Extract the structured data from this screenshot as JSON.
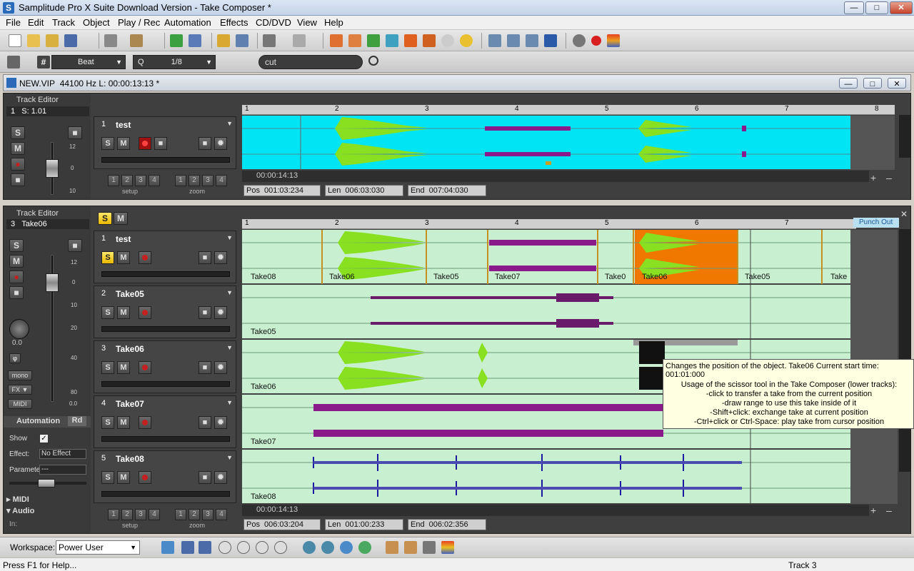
{
  "window": {
    "title": "Samplitude Pro X Suite Download Version - Take Composer *"
  },
  "menu": [
    "File",
    "Edit",
    "Track",
    "Object",
    "Play / Rec",
    "Automation",
    "Effects",
    "CD/DVD",
    "View",
    "Help"
  ],
  "toolbar2": {
    "snap_mode": "Beat",
    "q_label": "Q",
    "quantize": "1/8",
    "search_value": "cut"
  },
  "project": {
    "name": "NEW.VIP",
    "info": "44100 Hz L: 00:00:13:13 *"
  },
  "upper": {
    "panel_title": "Track Editor",
    "track_select": "1",
    "track_sub": "S: 1.01",
    "track": {
      "num": "1",
      "name": "test"
    },
    "setup_label": "setup",
    "zoom_label": "zoom",
    "nums": [
      "1",
      "2",
      "3",
      "4"
    ],
    "ruler": [
      "1",
      "2",
      "3",
      "4",
      "5",
      "6",
      "7",
      "8"
    ],
    "time": "00:00:14:13",
    "pos_label": "Pos",
    "pos": "001:03:234",
    "len_label": "Len",
    "len": "006:03:030",
    "end_label": "End",
    "end": "007:04:030",
    "meter": [
      "12",
      "0",
      "10"
    ]
  },
  "lower": {
    "panel_title": "Track Editor",
    "track_select": "3",
    "track_sub": "Take06",
    "punch_out": "Punch Out",
    "pan_value": "0.0",
    "tracks": [
      {
        "num": "1",
        "name": "test"
      },
      {
        "num": "2",
        "name": "Take05"
      },
      {
        "num": "3",
        "name": "Take06"
      },
      {
        "num": "4",
        "name": "Take07"
      },
      {
        "num": "5",
        "name": "Take08"
      }
    ],
    "takes_row1": [
      "Take08",
      "Take06",
      "Take05",
      "Take07",
      "Take0",
      "Take06",
      "Take05",
      "Take"
    ],
    "lane_labels": [
      "Take05",
      "Take06",
      "Take07",
      "Take08"
    ],
    "ruler": [
      "1",
      "2",
      "3",
      "4",
      "5",
      "6",
      "7"
    ],
    "time": "00:00:14:13",
    "pos_label": "Pos",
    "pos": "006:03:204",
    "len_label": "Len",
    "len": "001:00:233",
    "end_label": "End",
    "end": "006:02:356",
    "meter": [
      "12",
      "0",
      "10",
      "20",
      "40",
      "80"
    ],
    "meter_bottom": "0.0",
    "mono": "mono",
    "fx": "FX",
    "midi_btn": "MIDI",
    "automation_label": "Automation",
    "automation_mode": "Rd",
    "show_label": "Show",
    "effect_label": "Effect:",
    "effect_value": "No Effect",
    "param_label": "Parameter",
    "param_value": "---",
    "midi_section": "MIDI",
    "audio_section": "Audio",
    "in_label": "In:",
    "setup_label": "setup",
    "zoom_label": "zoom",
    "nums": [
      "1",
      "2",
      "3",
      "4"
    ]
  },
  "tooltip": {
    "line1": "Changes the position of the object. Take06 Current start time: 001:01:000",
    "lines": [
      "Usage of the scissor tool in the Take Composer (lower tracks):",
      "-click to transfer a take from the current position",
      "-draw range to use this take inside of it",
      "-Shift+click: exchange take at current position",
      "-Ctrl+click or Ctrl-Space: play take from cursor position"
    ]
  },
  "workspace": {
    "label": "Workspace:",
    "value": "Power User"
  },
  "status": {
    "left": "Press F1 for Help...",
    "right": "Track 3"
  },
  "colors": {
    "take_selected": "#f07800",
    "take_bg": "#c8f0d0",
    "wave_green": "#88e020",
    "wave_purple": "#8a1a8a",
    "wave_blue": "#1a1aa0",
    "upper_bg": "#00e0f0"
  }
}
